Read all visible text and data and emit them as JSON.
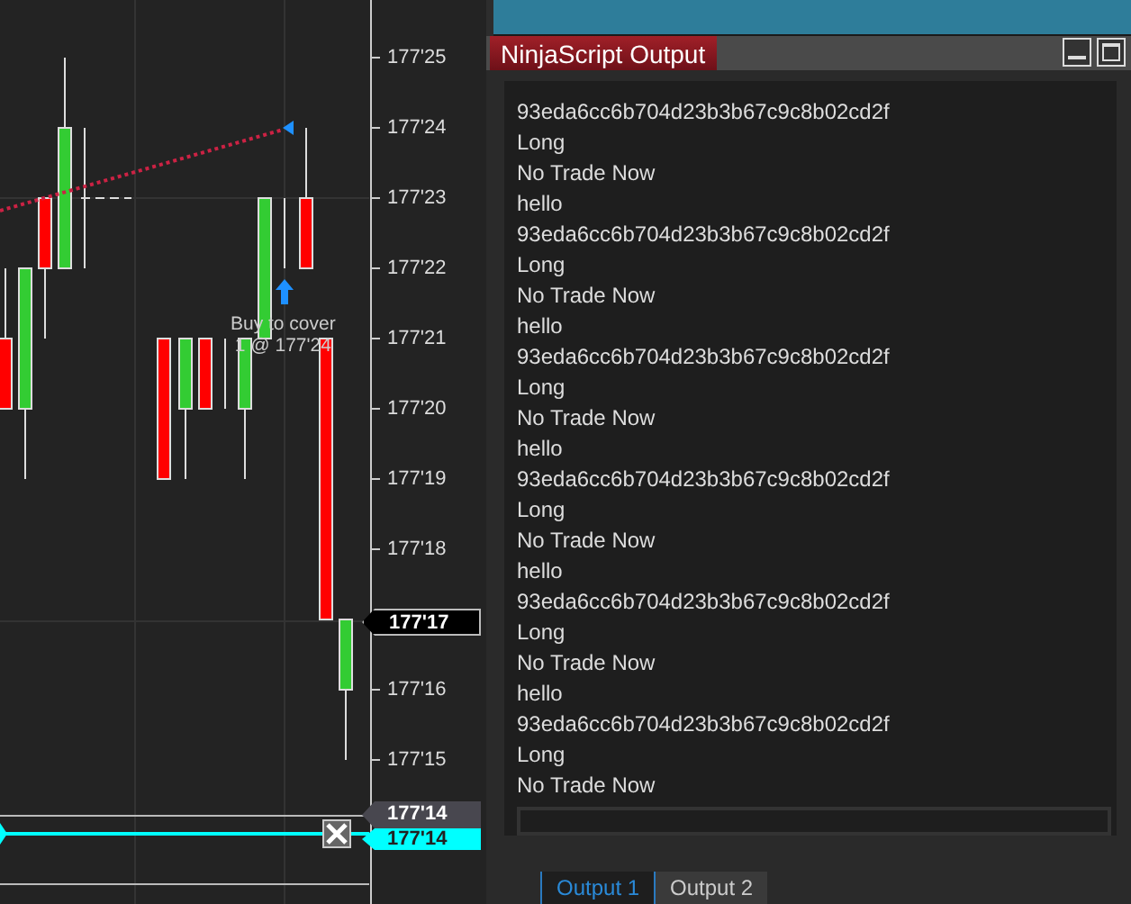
{
  "chart": {
    "price_labels": [
      "177'25",
      "177'24",
      "177'23",
      "177'22",
      "177'21",
      "177'20",
      "177'19",
      "177'18",
      "177'16",
      "177'15"
    ],
    "last_price": "177'17",
    "order_labels": [
      {
        "text": "177'14",
        "kind": "pending"
      },
      {
        "text": "177'14",
        "kind": "stop"
      }
    ],
    "execution": {
      "action": "Buy to cover",
      "detail": "1 @ 177'24"
    }
  },
  "output_window": {
    "title": "NinjaScript Output",
    "lines": [
      "93eda6cc6b704d23b3b67c9c8b02cd2f",
      "Long",
      "No Trade Now",
      "hello",
      "93eda6cc6b704d23b3b67c9c8b02cd2f",
      "Long",
      "No Trade Now",
      "hello",
      "93eda6cc6b704d23b3b67c9c8b02cd2f",
      "Long",
      "No Trade Now",
      "hello",
      "93eda6cc6b704d23b3b67c9c8b02cd2f",
      "Long",
      "No Trade Now",
      "hello",
      "93eda6cc6b704d23b3b67c9c8b02cd2f",
      "Long",
      "No Trade Now",
      "hello",
      "93eda6cc6b704d23b3b67c9c8b02cd2f",
      "Long",
      "No Trade Now"
    ],
    "tabs": [
      {
        "label": "Output 1",
        "selected": true
      },
      {
        "label": "Output 2",
        "selected": false
      }
    ]
  }
}
